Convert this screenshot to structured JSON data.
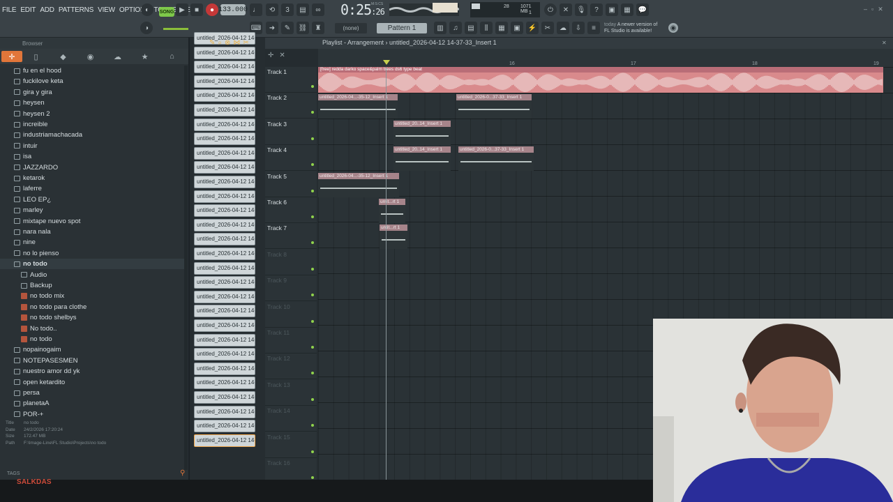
{
  "menu": [
    "FILE",
    "EDIT",
    "ADD",
    "PATTERNS",
    "VIEW",
    "OPTIONS",
    "TOOLS",
    "HELP"
  ],
  "transport": {
    "mode": "SONG",
    "tempo": "133.000",
    "time_main": "0:25",
    "time_sub": ":26",
    "time_label": "M:S:CS"
  },
  "monitor": {
    "cpu": "28",
    "memory": "1071 MB",
    "poly": "1"
  },
  "toolbar2": {
    "none": "(none)",
    "pattern": "Pattern 1"
  },
  "news": {
    "when": "today",
    "text1": "A newer version of",
    "text2": "FL Studio is available!"
  },
  "browser": {
    "title": "Browser",
    "items": [
      {
        "label": "fu en el hood",
        "type": "folder",
        "indent": 0
      },
      {
        "label": "fuckilove keta",
        "type": "folder",
        "indent": 0
      },
      {
        "label": "gira y gira",
        "type": "folder",
        "indent": 0
      },
      {
        "label": "heysen",
        "type": "folder",
        "indent": 0
      },
      {
        "label": "heysen 2",
        "type": "folder",
        "indent": 0
      },
      {
        "label": "increible",
        "type": "folder",
        "indent": 0
      },
      {
        "label": "industriamachacada",
        "type": "folder",
        "indent": 0
      },
      {
        "label": "intuir",
        "type": "folder",
        "indent": 0
      },
      {
        "label": "isa",
        "type": "folder",
        "indent": 0
      },
      {
        "label": "JAZZARDO",
        "type": "folder",
        "indent": 0
      },
      {
        "label": "ketarok",
        "type": "folder",
        "indent": 0
      },
      {
        "label": "laferre",
        "type": "folder",
        "indent": 0
      },
      {
        "label": "LEO EP¿",
        "type": "folder",
        "indent": 0
      },
      {
        "label": "marley",
        "type": "folder",
        "indent": 0
      },
      {
        "label": "mixtape nuevo spot",
        "type": "folder",
        "indent": 0
      },
      {
        "label": "nara nala",
        "type": "folder",
        "indent": 0
      },
      {
        "label": "nine",
        "type": "folder",
        "indent": 0
      },
      {
        "label": "no lo pienso",
        "type": "folder",
        "indent": 0
      },
      {
        "label": "no todo",
        "type": "folder-open",
        "indent": 0
      },
      {
        "label": "Audio",
        "type": "folder",
        "indent": 1
      },
      {
        "label": "Backup",
        "type": "folder",
        "indent": 1
      },
      {
        "label": "no todo mix",
        "type": "file",
        "indent": 1
      },
      {
        "label": "no todo para clothe",
        "type": "file",
        "indent": 1
      },
      {
        "label": "no todo shelbys",
        "type": "file",
        "indent": 1
      },
      {
        "label": "No todo..",
        "type": "file",
        "indent": 1
      },
      {
        "label": "no todo",
        "type": "file",
        "indent": 1
      },
      {
        "label": "nopainogaim",
        "type": "folder",
        "indent": 0
      },
      {
        "label": "NOTEPASESMEN",
        "type": "folder",
        "indent": 0
      },
      {
        "label": "nuestro amor dd yk",
        "type": "folder",
        "indent": 0
      },
      {
        "label": "open ketardito",
        "type": "folder",
        "indent": 0
      },
      {
        "label": "persa",
        "type": "folder",
        "indent": 0
      },
      {
        "label": "planetaA",
        "type": "folder",
        "indent": 0
      },
      {
        "label": "POR-+",
        "type": "folder",
        "indent": 0
      }
    ],
    "info": {
      "title_k": "Title",
      "title_v": "no todo",
      "date_k": "Date",
      "date_v": "24/2/2026 17:20:24",
      "size_k": "Size",
      "size_v": "172.47 MB",
      "path_k": "Path",
      "path_v": "F:\\Image-Line\\FL Studio\\Projects\\no todo"
    },
    "tags": "TAGS"
  },
  "clip_label": "untitled_2026-04-12 14-",
  "clip_count": 29,
  "playlist": {
    "title": "Playlist - Arrangement › untitled_2026-04-12 14-37-33_Insert 1",
    "bars": [
      "15",
      "16",
      "17",
      "18",
      "19"
    ],
    "tracks": [
      "Track 1",
      "Track 2",
      "Track 3",
      "Track 4",
      "Track 5",
      "Track 6",
      "Track 7",
      "Track 8",
      "Track 9",
      "Track 10",
      "Track 11",
      "Track 12",
      "Track 13",
      "Track 14",
      "Track 15",
      "Track 16"
    ],
    "active_tracks": 7,
    "clips": [
      {
        "track": 1,
        "label": "untitled_2026-04...-35-12_Insert 1"
      },
      {
        "track": 1,
        "label": "untitled_2026-0...37-33_Insert 1"
      },
      {
        "track": 2,
        "label": "untitled_20..14_Insert 1"
      },
      {
        "track": 3,
        "label": "untitled_20..14_Insert 1"
      },
      {
        "track": 3,
        "label": "untitled_2026-0...37-33_Insert 1"
      },
      {
        "track": 4,
        "label": "untitled_2026-04...-35-12_Insert 1"
      },
      {
        "track": 5,
        "label": "untit...rt 1"
      },
      {
        "track": 6,
        "label": "untit...rt 1"
      }
    ],
    "main_clip": "[free] redda  darko  space&palm trees  ds6 type beat"
  },
  "overlay_text": "SALKDAS"
}
